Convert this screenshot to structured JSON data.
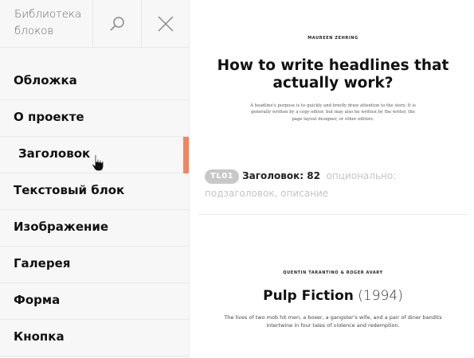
{
  "sidebar": {
    "title": "Библиотека блоков",
    "search_icon": "search-icon",
    "close_icon": "close-icon",
    "items": [
      {
        "label": "Обложка"
      },
      {
        "label": "О проекте"
      },
      {
        "label": "Заголовок",
        "active": true
      },
      {
        "label": "Текстовый блок"
      },
      {
        "label": "Изображение"
      },
      {
        "label": "Галерея"
      },
      {
        "label": "Форма"
      },
      {
        "label": "Кнопка"
      }
    ],
    "active_color": "#f4845f"
  },
  "preview": {
    "card1": {
      "author": "MAUREEN ZEHRING",
      "headline": "How to write headlines that actually work?",
      "description": "A headline's purpose is to quickly and briefly draw attention to the story. It is generally written by a copy editor, but may also be written by the writer, the page layout designer, or other editors."
    },
    "block_meta": {
      "code": "TL01",
      "name": "Заголовок: 82",
      "details": "опционально: подзаголовок, описание"
    },
    "card2": {
      "author": "QUENTIN TARANTINO & ROGER AVARY",
      "title": "Pulp Fiction",
      "year": "(1994)",
      "description": "The lives of two mob hit men, a boxer, a gangster's wife, and a pair of diner bandits intertwine in four tales of violence and redemption."
    }
  }
}
